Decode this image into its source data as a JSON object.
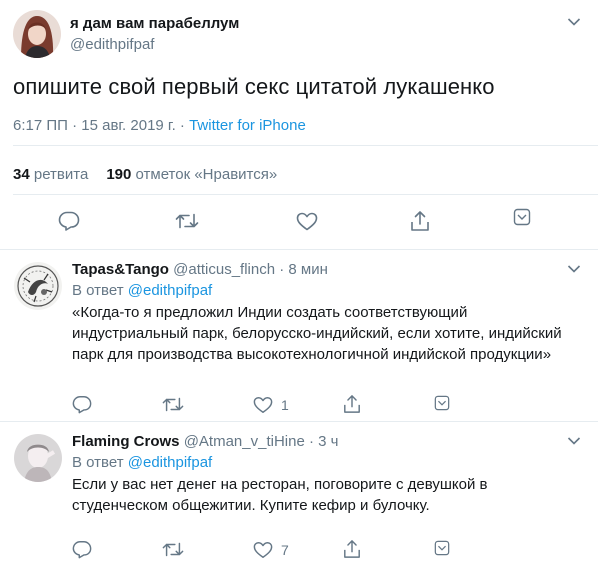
{
  "main_tweet": {
    "author_name": "я дам вам парабеллум",
    "author_handle": "@edithpifpaf",
    "text": "опишите свой первый секс цитатой лукашенко",
    "time": "6:17 ПП · 15 авг. 2019 г. · ",
    "source": "Twitter for iPhone",
    "retweets_count": "34",
    "retweets_label": "ретвита",
    "likes_count": "190",
    "likes_label": "отметок «Нравится»"
  },
  "replies": [
    {
      "author_name": "Tapas&Tango",
      "author_handle": "@atticus_flinch",
      "separator": " · ",
      "time": "8 мин",
      "reply_prefix": "В ответ ",
      "reply_to": "@edithpifpaf",
      "text": "«Когда-то я предложил Индии создать соответствующий индустриальный парк, белорусско-индийский, если хотите, индийский парк для производства высокотехнологичной индийской продукции»",
      "like_count": "1"
    },
    {
      "author_name": "Flaming Crows",
      "author_handle": "@Atman_v_tiHine",
      "separator": " · ",
      "time": "3 ч",
      "reply_prefix": "В ответ ",
      "reply_to": "@edithpifpaf",
      "text": "Если у вас нет денег на ресторан, поговорите с девушкой в студенческом общежитии. Купите кефир и булочку.",
      "like_count": "7"
    }
  ],
  "colors": {
    "accent": "#1b95e0",
    "secondary_text": "#657786",
    "primary_text": "#14171a",
    "divider": "#e6ecf0"
  },
  "icons": [
    "reply-icon",
    "retweet-icon",
    "like-icon",
    "share-icon",
    "chevron-down-icon"
  ]
}
